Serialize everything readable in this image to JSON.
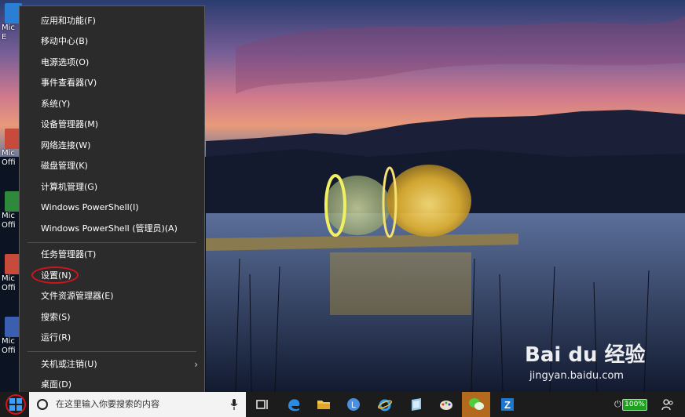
{
  "desktop": {
    "icons": [
      {
        "label": "Mic",
        "label2": "E"
      },
      {
        "label": "Mic",
        "label2": "Offi"
      },
      {
        "label": "Mic",
        "label2": "Offi"
      },
      {
        "label": "Mic",
        "label2": "Offi"
      },
      {
        "label": "Mic",
        "label2": "Offi"
      }
    ]
  },
  "menu": {
    "items": [
      {
        "label": "应用和功能(F)"
      },
      {
        "label": "移动中心(B)"
      },
      {
        "label": "电源选项(O)"
      },
      {
        "label": "事件查看器(V)"
      },
      {
        "label": "系统(Y)"
      },
      {
        "label": "设备管理器(M)"
      },
      {
        "label": "网络连接(W)"
      },
      {
        "label": "磁盘管理(K)"
      },
      {
        "label": "计算机管理(G)"
      },
      {
        "label": "Windows PowerShell(I)"
      },
      {
        "label": "Windows PowerShell (管理员)(A)"
      },
      {
        "label": "任务管理器(T)"
      },
      {
        "label": "设置(N)"
      },
      {
        "label": "文件资源管理器(E)"
      },
      {
        "label": "搜索(S)"
      },
      {
        "label": "运行(R)"
      },
      {
        "label": "关机或注销(U)"
      },
      {
        "label": "桌面(D)"
      }
    ],
    "submenu_arrow": "›"
  },
  "taskbar": {
    "search_placeholder": "在这里输入你要搜索的内容",
    "battery": "100%"
  },
  "watermark": {
    "logo": "Bai du 经验",
    "url": "jingyan.baidu.com"
  },
  "colors": {
    "menu_bg": "#2b2b2b",
    "highlight": "#d4141c",
    "taskbar_bg": "#1c1c1c",
    "active_app": "#b36a1e"
  }
}
